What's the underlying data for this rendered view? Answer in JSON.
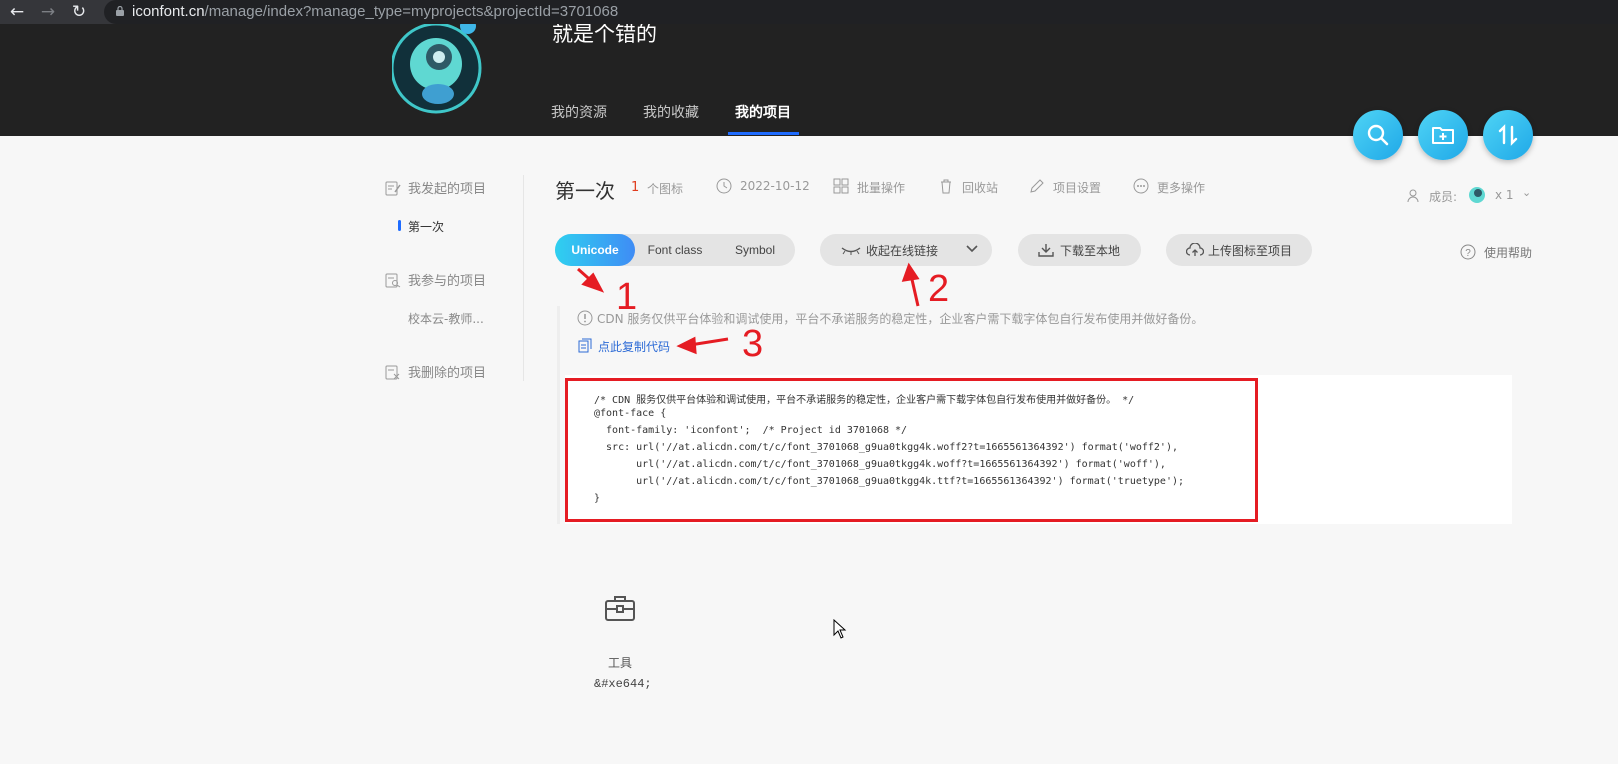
{
  "browser": {
    "url_host": "iconfont.cn",
    "url_path": "/manage/index?manage_type=myprojects&projectId=3701068",
    "back_icon": "arrow-left-icon",
    "forward_icon": "arrow-right-icon",
    "reload_icon": "reload-icon"
  },
  "header": {
    "username": "就是个错的",
    "tabs": [
      {
        "label": "我的资源"
      },
      {
        "label": "我的收藏"
      },
      {
        "label": "我的项目",
        "active": true
      }
    ],
    "fabs": [
      "search-icon",
      "new-folder-icon",
      "sort-icon"
    ]
  },
  "sidebar": {
    "initiated": {
      "label": "我发起的项目",
      "items": [
        "第一次"
      ]
    },
    "joined": {
      "label": "我参与的项目",
      "items": [
        "校本云-教师..."
      ]
    },
    "deleted": {
      "label": "我删除的项目"
    }
  },
  "project": {
    "title": "第一次",
    "icon_count": "1",
    "icon_count_label": "个图标",
    "date": "2022-10-12",
    "actions": {
      "batch": "批量操作",
      "recycle": "回收站",
      "settings": "项目设置",
      "more": "更多操作"
    },
    "members_label": "成员:",
    "members_count": "x 1"
  },
  "toolbar": {
    "modes": [
      "Unicode",
      "Font class",
      "Symbol"
    ],
    "active_mode": "Unicode",
    "collapse_link": "收起在线链接",
    "download": "下载至本地",
    "upload": "上传图标至项目",
    "help": "使用帮助"
  },
  "cdn": {
    "note": "CDN 服务仅供平台体验和调试使用，平台不承诺服务的稳定性，企业客户需下载字体包自行发布使用并做好备份。",
    "copy_label": "点此复制代码",
    "code_lines": [
      "/* CDN 服务仅供平台体验和调试使用，平台不承诺服务的稳定性，企业客户需下载字体包自行发布使用并做好备份。 */",
      "@font-face {",
      "  font-family: 'iconfont';  /* Project id 3701068 */",
      "  src: url('//at.alicdn.com/t/c/font_3701068_g9ua0tkgg4k.woff2?t=1665561364392') format('woff2'),",
      "       url('//at.alicdn.com/t/c/font_3701068_g9ua0tkgg4k.woff?t=1665561364392') format('woff'),",
      "       url('//at.alicdn.com/t/c/font_3701068_g9ua0tkgg4k.ttf?t=1665561364392') format('truetype');",
      "}"
    ]
  },
  "icons": [
    {
      "name": "工具",
      "code": "&#xe644;",
      "icon": "toolbox-icon"
    }
  ],
  "annotations": [
    "1",
    "2",
    "3"
  ],
  "colors": {
    "accent": "#1f6cff",
    "annotation": "#e51c23",
    "count": "#e03c1e"
  }
}
